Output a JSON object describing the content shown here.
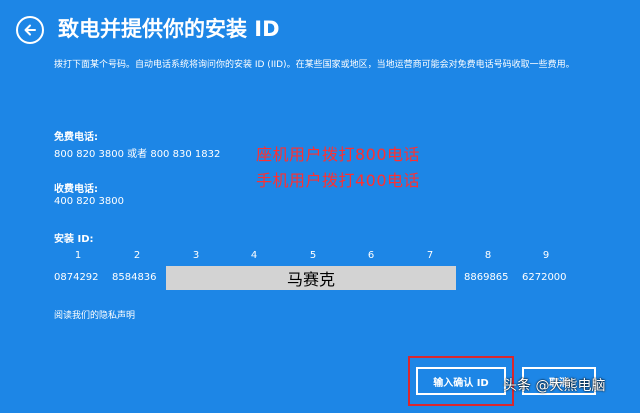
{
  "header": {
    "title": "致电并提供你的安装 ID"
  },
  "description": "拨打下面某个号码。自动电话系统将询问你的安装 ID (IID)。在某些国家或地区，当地运营商可能会对免费电话号码收取一些费用。",
  "free_phone": {
    "label": "免费电话:",
    "value": "800 820 3800 或者 800 830 1832"
  },
  "paid_phone": {
    "label": "收费电话:",
    "value": "400 820 3800"
  },
  "annotations": {
    "line1": "座机用户拨打800电话",
    "line2": "手机用户拨打400电话"
  },
  "install_id": {
    "label": "安装 ID:",
    "indices": [
      "1",
      "2",
      "3",
      "4",
      "5",
      "6",
      "7",
      "8",
      "9"
    ],
    "values": [
      "0874292",
      "8584836",
      "8869865",
      "6272000"
    ],
    "mask_text": "马赛克"
  },
  "privacy_link": "阅读我们的隐私声明",
  "buttons": {
    "enter_id": "输入确认 ID",
    "cancel": "取消"
  },
  "watermark": "头条 @大熊电脑",
  "colors": {
    "background": "#1d86e6",
    "annotation": "#ff3030",
    "highlight_box": "#d9272e",
    "mask": "#d3d3d3"
  },
  "icons": {
    "back": "back-arrow-icon"
  }
}
